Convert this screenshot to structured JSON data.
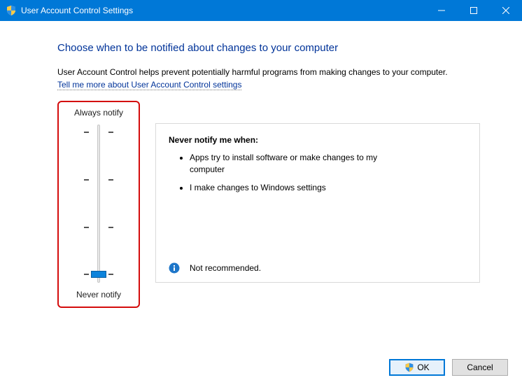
{
  "window": {
    "title": "User Account Control Settings"
  },
  "heading": "Choose when to be notified about changes to your computer",
  "description": "User Account Control helps prevent potentially harmful programs from making changes to your computer.",
  "help_link": "Tell me more about User Account Control settings",
  "slider": {
    "top_label": "Always notify",
    "bottom_label": "Never notify",
    "levels": 4,
    "current_level": 0
  },
  "info_panel": {
    "title": "Never notify me when:",
    "bullets": [
      "Apps try to install software or make changes to my computer",
      "I make changes to Windows settings"
    ],
    "footer_text": "Not recommended."
  },
  "buttons": {
    "ok": "OK",
    "cancel": "Cancel"
  }
}
